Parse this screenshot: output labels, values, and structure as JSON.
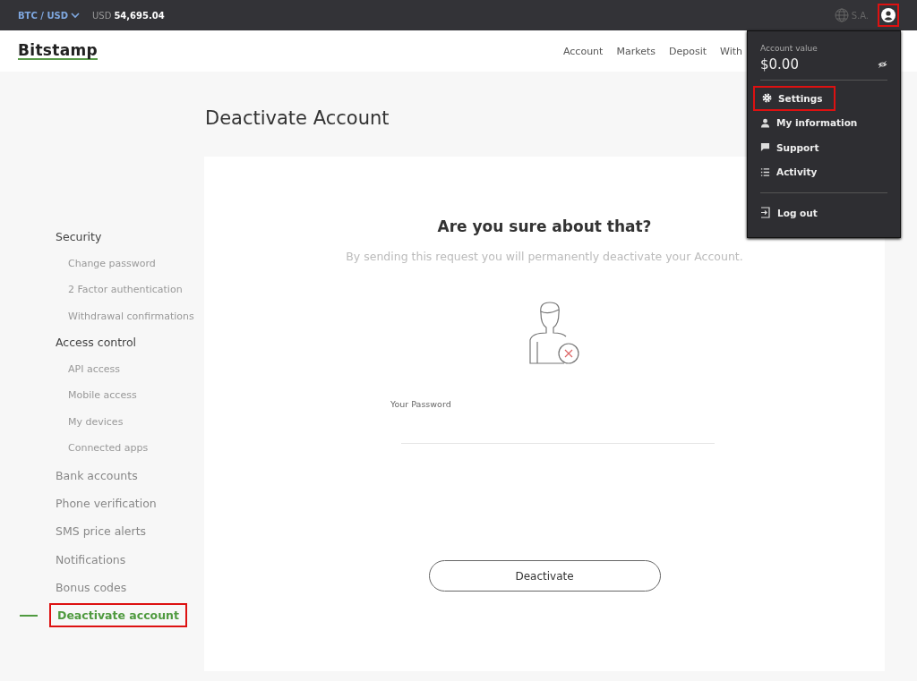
{
  "top_bar": {
    "pair": "BTC / USD",
    "price_label": "USD",
    "price": "54,695.04",
    "region": "S.A."
  },
  "nav": {
    "logo": "Bitstamp",
    "links": [
      "Account",
      "Markets",
      "Deposit",
      "With"
    ]
  },
  "page_title": "Deactivate Account",
  "sidebar": [
    {
      "label": "Security",
      "selected": false,
      "annotated": false,
      "children": [
        {
          "label": "Change password",
          "selected": false,
          "annotated": false
        },
        {
          "label": "2 Factor authentication",
          "selected": false,
          "annotated": false
        },
        {
          "label": "Withdrawal confirmations",
          "selected": false,
          "annotated": false
        }
      ]
    },
    {
      "label": "Access control",
      "selected": false,
      "annotated": false,
      "children": [
        {
          "label": "API access",
          "selected": false,
          "annotated": false
        },
        {
          "label": "Mobile access",
          "selected": false,
          "annotated": false
        },
        {
          "label": "My devices",
          "selected": false,
          "annotated": false
        },
        {
          "label": "Connected apps",
          "selected": false,
          "annotated": false
        }
      ]
    },
    {
      "label": "Bank accounts",
      "selected": false,
      "annotated": false
    },
    {
      "label": "Phone verification",
      "selected": false,
      "annotated": false
    },
    {
      "label": "SMS price alerts",
      "selected": false,
      "annotated": false
    },
    {
      "label": "Notifications",
      "selected": false,
      "annotated": false
    },
    {
      "label": "Bonus codes",
      "selected": false,
      "annotated": false
    },
    {
      "label": "Deactivate account",
      "selected": true,
      "annotated": true
    }
  ],
  "card": {
    "heading": "Are you sure about that?",
    "description": "By sending this request you will permanently deactivate your Account.",
    "password_label": "Your Password",
    "button": "Deactivate"
  },
  "account_menu": {
    "open": true,
    "annotated": true,
    "value_label": "Account value",
    "value": "$0.00",
    "items": [
      {
        "kind": "settings",
        "label": "Settings",
        "annotated": true
      },
      {
        "kind": "info",
        "label": "My information",
        "annotated": false
      },
      {
        "kind": "support",
        "label": "Support",
        "annotated": false
      },
      {
        "kind": "activity",
        "label": "Activity",
        "annotated": false
      },
      {
        "kind": "logout",
        "label": "Log out",
        "annotated": false
      }
    ]
  }
}
